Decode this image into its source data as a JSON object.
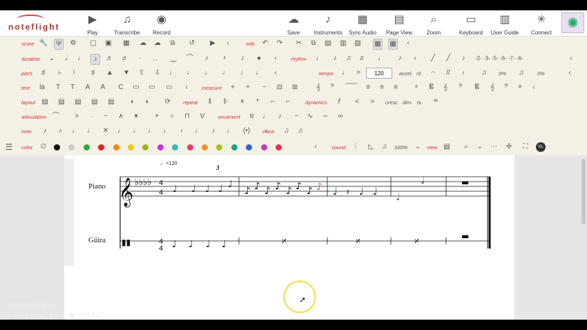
{
  "brand": {
    "logo": "noteflight"
  },
  "toolbar": [
    {
      "label": "Play",
      "icon": "play-icon"
    },
    {
      "label": "Transcribe",
      "icon": "transcribe-icon"
    },
    {
      "label": "Record",
      "icon": "record-icon"
    },
    {
      "label": "Save",
      "icon": "cloud-save-icon"
    },
    {
      "label": "Instruments",
      "icon": "guitar-icon"
    },
    {
      "label": "Sync Audio",
      "icon": "sync-audio-icon"
    },
    {
      "label": "Page View",
      "icon": "page-view-icon"
    },
    {
      "label": "Zoom",
      "icon": "zoom-icon"
    },
    {
      "label": "Keyboard",
      "icon": "keyboard-icon"
    },
    {
      "label": "User Guide",
      "icon": "book-icon"
    },
    {
      "label": "Connect",
      "icon": "connect-icon"
    }
  ],
  "palette": {
    "labels": {
      "score": "score",
      "duration": "duration",
      "pitch": "pitch",
      "text": "text",
      "layout": "layout",
      "articulation": "articulation",
      "note": "note",
      "color": "color"
    },
    "sections": {
      "edit": "edit",
      "rhythm": "rhythm",
      "tempo": "tempo",
      "measure": "measure",
      "repeat": "repeat",
      "dynamics": "dynamics",
      "ornament": "ornament",
      "voice": "voice",
      "sound": "sound",
      "view": "view"
    },
    "tempo_value": "120",
    "pitch_pct1": "0%",
    "pitch_pct2": "0%",
    "sound_pct": "100%",
    "dyn_words": {
      "cresc": "cresc.",
      "dim": "dim.",
      "tx": "tx.",
      "accel": "accel.",
      "rit": "rit."
    },
    "colors": [
      "#111111",
      "#cccccc",
      "#2eaa3a",
      "#e02020",
      "#f08a1a",
      "#f0c81a",
      "#9ab41e",
      "#cc33cc",
      "#33bbbb",
      "#e04060",
      "#f09030",
      "#b0c020",
      "#20a080",
      "#3060d0",
      "#c040b0",
      "#e03050"
    ]
  },
  "score": {
    "tempo_marking": "♩=120",
    "tuplet": "3",
    "instruments": [
      "Piano",
      "Güira"
    ]
  },
  "watermark": {
    "line1": "RECORDED WITH",
    "line2": "SCREENCAST",
    "line3": "MATIC"
  }
}
